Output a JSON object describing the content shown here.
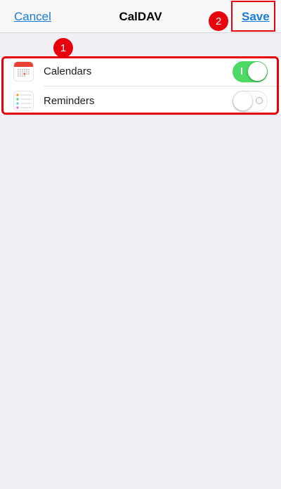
{
  "theme": {
    "accent": "#1a7dd9",
    "annotation": "#e8000c",
    "toggle_on": "#4cd964"
  },
  "navbar": {
    "cancel_label": "Cancel",
    "title": "CalDAV",
    "save_label": "Save"
  },
  "annotations": {
    "callout_1": "1",
    "callout_2": "2"
  },
  "settings": {
    "items": [
      {
        "label": "Calendars",
        "icon": "calendar-icon",
        "enabled": true
      },
      {
        "label": "Reminders",
        "icon": "reminders-icon",
        "enabled": false
      }
    ]
  }
}
